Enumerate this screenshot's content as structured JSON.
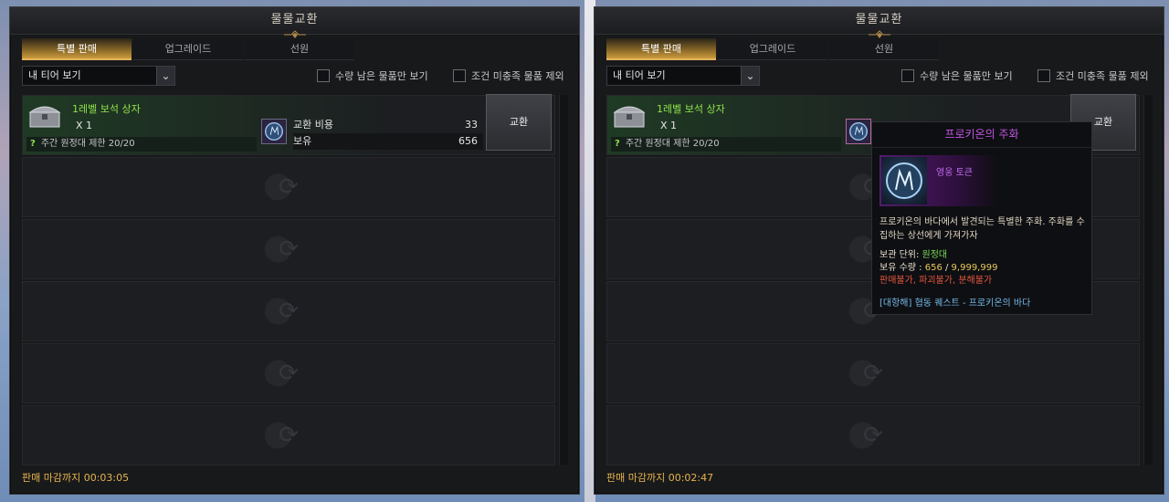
{
  "panels": [
    {
      "title": "물물교환",
      "tabs": [
        {
          "label": "특별 판매",
          "active": true
        },
        {
          "label": "업그레이드",
          "active": false
        },
        {
          "label": "선원",
          "active": false
        }
      ],
      "filter": {
        "dropdown_value": "내 티어 보기",
        "checkbox_remaining": "수량 남은 물품만 보기",
        "checkbox_condition": "조건 미충족 물품 제외"
      },
      "item": {
        "name": "1레벨 보석 상자",
        "quantity": "X 1",
        "limit_icon": "?",
        "limit_text": "주간 원정대 제한 20/20",
        "cost_label": "교환 비용",
        "cost_value": "33",
        "owned_label": "보유",
        "owned_value": "656",
        "exchange_label": "교환"
      },
      "footer": "판매 마감까지 00:03:05"
    },
    {
      "title": "물물교환",
      "tabs": [
        {
          "label": "특별 판매",
          "active": true
        },
        {
          "label": "업그레이드",
          "active": false
        },
        {
          "label": "선원",
          "active": false
        }
      ],
      "filter": {
        "dropdown_value": "내 티어 보기",
        "checkbox_remaining": "수량 남은 물품만 보기",
        "checkbox_condition": "조건 미충족 물품 제외"
      },
      "item": {
        "name": "1레벨 보석 상자",
        "quantity": "X 1",
        "limit_icon": "?",
        "limit_text": "주간 원정대 제한 20/20",
        "exchange_label": "교환"
      },
      "footer": "판매 마감까지 00:02:47"
    }
  ],
  "tooltip": {
    "title": "프로키온의 주화",
    "grade": "영웅 토큰",
    "description": "프로키온의 바다에서 발견되는 특별한 주화. 주화를 수집하는 상선에게 가져가자",
    "storage_label": "보관 단위: ",
    "storage_value": "원정대",
    "owned_label": "보유 수량 : ",
    "owned_current": "656",
    "owned_sep": " / ",
    "owned_max": "9,999,999",
    "restrictions": "판매불가, 파괴불가, 분해불가",
    "source": "[대항해] 협동 퀘스트 - 프로키온의 바다"
  },
  "icons": {
    "dropdown": "chevron-down-icon",
    "placeholder": "exchange-arrows-icon",
    "chest": "treasure-chest-icon",
    "token": "procyon-coin-icon"
  },
  "colors": {
    "accent_gold": "#e4b45a",
    "item_green": "#8fe34a",
    "tooltip_title": "#c455e4",
    "footer_timer": "#e6b44c"
  }
}
